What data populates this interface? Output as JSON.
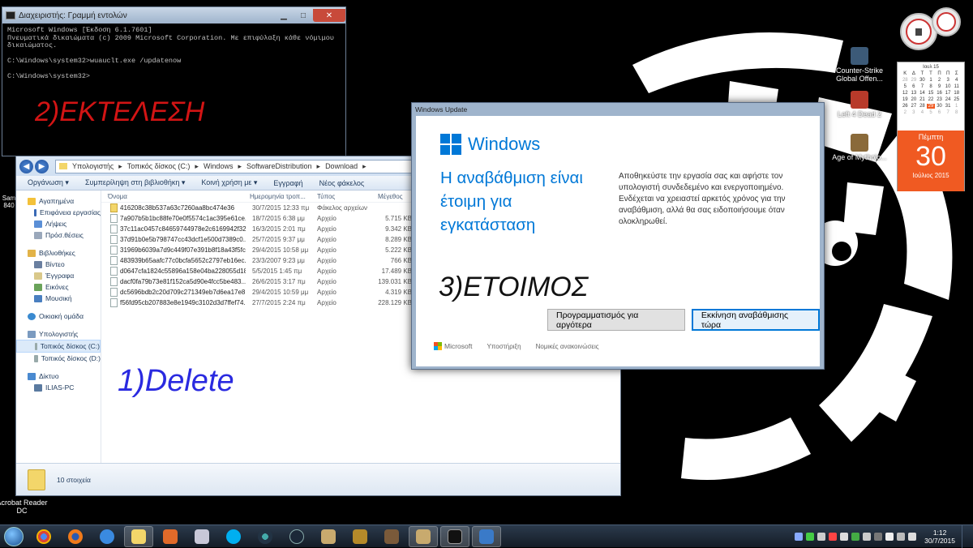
{
  "cmd": {
    "title": "Διαχειριστής: Γραμμή εντολών",
    "lines": [
      "Microsoft Windows [Έκδοση 6.1.7601]",
      "Πνευματικά δικαιώματα (c) 2009 Microsoft Corporation. Με επιφύλαξη κάθε νόμιμου",
      "δικαιώματος.",
      "",
      "C:\\Windows\\system32>wuauclt.exe /updatenow",
      "",
      "C:\\Windows\\system32>"
    ],
    "annotation": "2)ΕΚΤΕΛΕΣΗ"
  },
  "explorer": {
    "breadcrumb": [
      "Υπολογιστής",
      "Τοπικός δίσκος (C:)",
      "Windows",
      "SoftwareDistribution",
      "Download"
    ],
    "toolbar": [
      "Οργάνωση ▾",
      "Συμπερίληψη στη βιβλιοθήκη ▾",
      "Κοινή χρήση με ▾",
      "Εγγραφή",
      "Νέος φάκελος"
    ],
    "nav": {
      "favorites": "Αγαπημένα",
      "desktop": "Επιφάνεια εργασίας",
      "downloads": "Λήψεις",
      "recent": "Πρόσ.θέσεις",
      "libraries": "Βιβλιοθήκες",
      "videos": "Βίντεο",
      "documents": "Έγγραφα",
      "pictures": "Εικόνες",
      "music": "Μουσική",
      "homegroup": "Οικιακή ομάδα",
      "computer": "Υπολογιστής",
      "drive_c": "Τοπικός δίσκος (C:)",
      "drive_d": "Τοπικός δίσκος (D:)",
      "network": "Δίκτυο",
      "pc": "ILIAS-PC"
    },
    "columns": [
      "Όνομα",
      "Ημερομηνία τροπ...",
      "Τύπος",
      "Μέγεθος"
    ],
    "files": [
      {
        "name": "416208c38b537a63c7260aa8bc474e36",
        "date": "30/7/2015 12:33 πμ",
        "type": "Φάκελος αρχείων",
        "size": "",
        "folder": true
      },
      {
        "name": "7a907b5b1bc88fe70e0f5574c1ac395e61ce...",
        "date": "18/7/2015 6:38 μμ",
        "type": "Αρχείο",
        "size": "5.715 KB"
      },
      {
        "name": "37c11ac0457c84659744978e2c6169942f32...",
        "date": "16/3/2015 2:01 πμ",
        "type": "Αρχείο",
        "size": "9.342 KB"
      },
      {
        "name": "37d91b0e5b798747cc43dcf1e500d7389c0...",
        "date": "25/7/2015 9:37 μμ",
        "type": "Αρχείο",
        "size": "8.289 KB"
      },
      {
        "name": "31969b6039a7d9c449f07e391b8f18a43f5fc...",
        "date": "29/4/2015 10:58 μμ",
        "type": "Αρχείο",
        "size": "5.222 KB"
      },
      {
        "name": "483939b65aafc77c0bcfa5652c2797eb16ec...",
        "date": "23/3/2007 9:23 μμ",
        "type": "Αρχείο",
        "size": "766 KB"
      },
      {
        "name": "d0647cfa1824c55896a158e04ba228055d18...",
        "date": "5/5/2015 1:45 πμ",
        "type": "Αρχείο",
        "size": "17.489 KB"
      },
      {
        "name": "dacf0fa79b73e81f152ca5d90e4fcc5be483...",
        "date": "26/6/2015 3:17 πμ",
        "type": "Αρχείο",
        "size": "139.031 KB"
      },
      {
        "name": "dc5696bdb2c20d709c271349eb7d6ea17e8...",
        "date": "29/4/2015 10:59 μμ",
        "type": "Αρχείο",
        "size": "4.319 KB"
      },
      {
        "name": "f56fd95cb207883e8e1949c3102d3d7ffef74...",
        "date": "27/7/2015 2:24 πμ",
        "type": "Αρχείο",
        "size": "228.129 KB"
      }
    ],
    "status": "10 στοιχεία",
    "annotation": "1)Delete"
  },
  "windows_update": {
    "title": "Windows Update",
    "brand": "Windows",
    "heading": "Η αναβάθμιση είναι έτοιμη για εγκατάσταση",
    "description": "Αποθηκεύστε την εργασία σας και αφήστε τον υπολογιστή συνδεδεμένο και ενεργοποιημένο. Ενδέχεται να χρειαστεί αρκετός χρόνος για την αναβάθμιση, αλλά θα σας ειδοποιήσουμε όταν ολοκληρωθεί.",
    "btn_later": "Προγραμματισμός για αργότερα",
    "btn_now": "Εκκίνηση αναβάθμισης τώρα",
    "footer": [
      "Microsoft",
      "Υποστήριξη",
      "Νομικές ανακοινώσεις"
    ],
    "annotation": "3)ΕΤΟΙΜΟΣ"
  },
  "desktop_icons": [
    {
      "label": "Counter-Strike Global Offen..."
    },
    {
      "label": "Left 4 Dead 2"
    },
    {
      "label": "Age of Mytholo..."
    },
    {
      "label": "Acrobat Reader DC"
    }
  ],
  "calendar": {
    "month": "Ιουλ 15",
    "weekdays": [
      "Κ",
      "Δ",
      "Τ",
      "Τ",
      "Π",
      "Π",
      "Σ"
    ],
    "days": [
      "28",
      "29",
      "30",
      "1",
      "2",
      "3",
      "4",
      "5",
      "6",
      "7",
      "8",
      "9",
      "10",
      "11",
      "12",
      "13",
      "14",
      "15",
      "16",
      "17",
      "18",
      "19",
      "20",
      "21",
      "22",
      "23",
      "24",
      "25",
      "26",
      "27",
      "28",
      "29",
      "30",
      "31",
      "1",
      "2",
      "3",
      "4",
      "5",
      "6",
      "7",
      "8"
    ],
    "weekday": "Πέμπτη",
    "day": "30",
    "month_year": "Ιούλιος 2015"
  },
  "taskbar": {
    "time": "1:12",
    "date": "30/7/2015"
  },
  "colors": {
    "accent": "#0078d7",
    "calendar_orange": "#f05a22"
  }
}
